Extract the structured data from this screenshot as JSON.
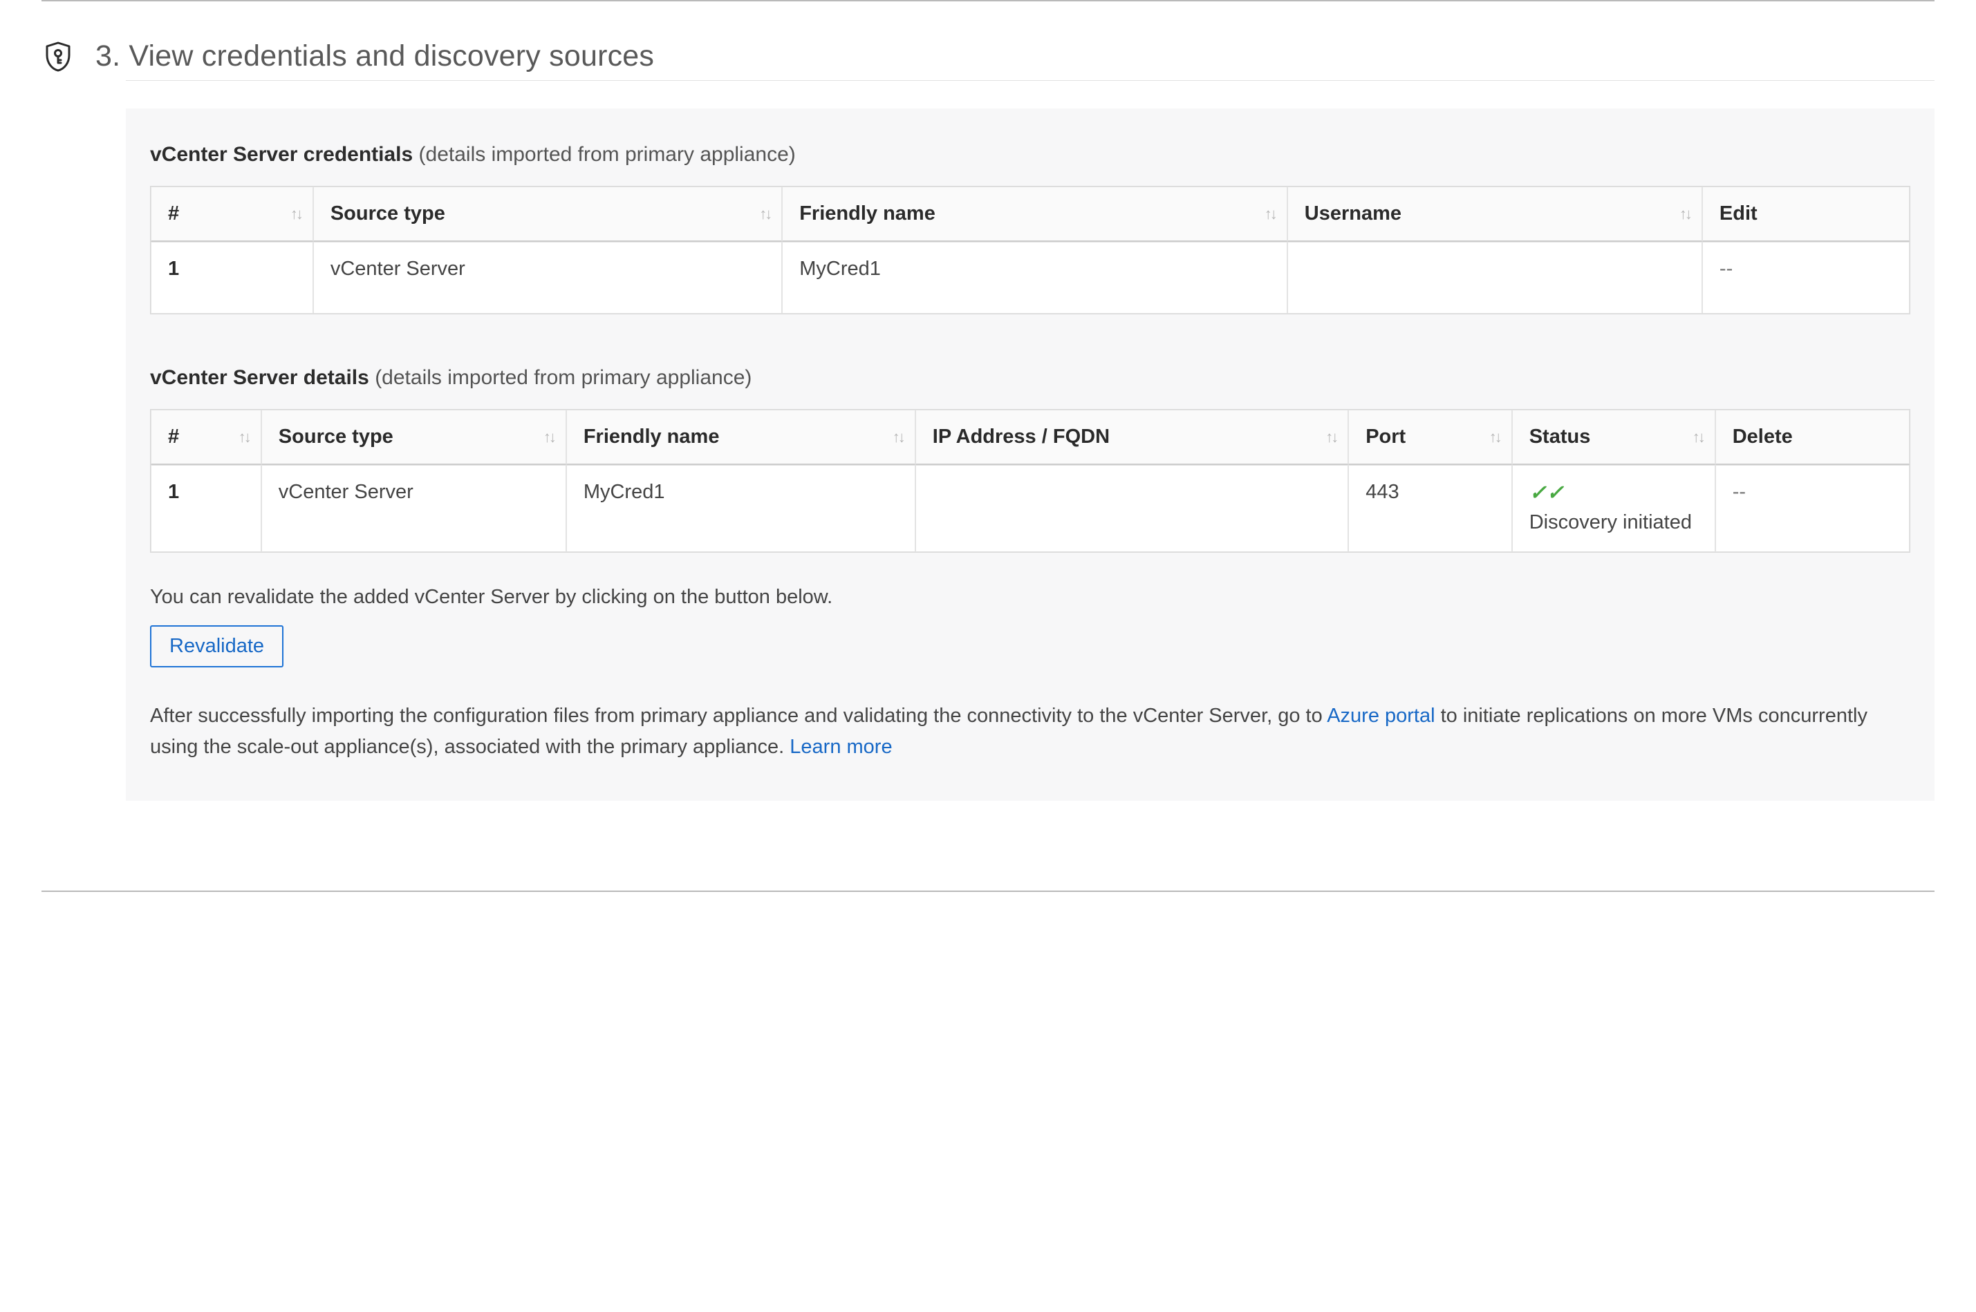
{
  "section": {
    "number": "3.",
    "title": "View credentials and discovery sources"
  },
  "credentials": {
    "heading_bold": "vCenter Server credentials",
    "heading_muted": "(details imported from primary appliance)",
    "columns": {
      "index": "#",
      "source_type": "Source type",
      "friendly_name": "Friendly name",
      "username": "Username",
      "edit": "Edit"
    },
    "rows": [
      {
        "index": "1",
        "source_type": "vCenter Server",
        "friendly_name": "MyCred1",
        "username": "",
        "edit": "--"
      }
    ]
  },
  "details": {
    "heading_bold": "vCenter Server details",
    "heading_muted": "(details imported from primary appliance)",
    "columns": {
      "index": "#",
      "source_type": "Source type",
      "friendly_name": "Friendly name",
      "ip_fqdn": "IP Address / FQDN",
      "port": "Port",
      "status": "Status",
      "delete": "Delete"
    },
    "rows": [
      {
        "index": "1",
        "source_type": "vCenter Server",
        "friendly_name": "MyCred1",
        "ip_fqdn": "",
        "port": "443",
        "status": "Discovery initiated",
        "delete": "--"
      }
    ]
  },
  "revalidate": {
    "help": "You can revalidate the added vCenter Server by clicking on the button below.",
    "button": "Revalidate"
  },
  "info": {
    "part1": "After successfully importing the configuration files from primary appliance and validating the connectivity to the vCenter Server, go to ",
    "link1": "Azure portal",
    "part2": " to initiate replications on more VMs concurrently using the scale-out appliance(s), associated with the primary appliance. ",
    "link2": "Learn more"
  }
}
